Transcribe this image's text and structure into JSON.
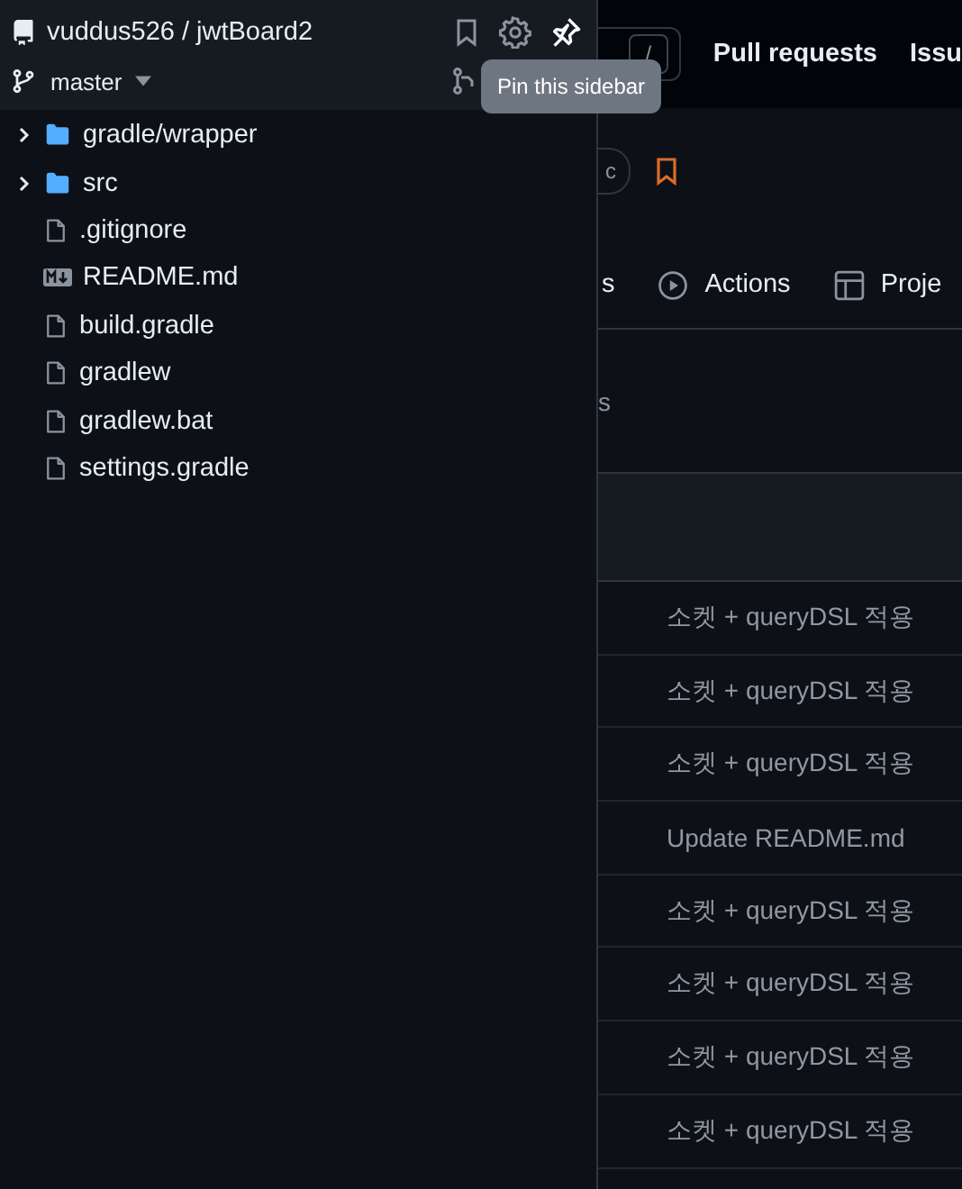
{
  "repo": "vuddus526 / jwtBoard2",
  "branch": "master",
  "tooltip": "Pin this sidebar",
  "tree": [
    {
      "name": "gradle/wrapper",
      "kind": "folder",
      "expanded": false
    },
    {
      "name": "src",
      "kind": "folder",
      "expanded": false
    },
    {
      "name": ".gitignore",
      "kind": "file"
    },
    {
      "name": "README.md",
      "kind": "markdown"
    },
    {
      "name": "build.gradle",
      "kind": "file"
    },
    {
      "name": "gradlew",
      "kind": "file"
    },
    {
      "name": "gradlew.bat",
      "kind": "file"
    },
    {
      "name": "settings.gradle",
      "kind": "file"
    }
  ],
  "header": {
    "slash_key": "/",
    "links": [
      "Pull requests",
      "Issu"
    ]
  },
  "repo_badge": "c",
  "nav": [
    "s",
    "Actions",
    "Proje"
  ],
  "section_text": "s",
  "commits": [
    "소켓 + queryDSL 적용",
    "소켓 + queryDSL 적용",
    "소켓 + queryDSL 적용",
    "Update README.md",
    "소켓 + queryDSL 적용",
    "소켓 + queryDSL 적용",
    "소켓 + queryDSL 적용",
    "소켓 + queryDSL 적용"
  ]
}
